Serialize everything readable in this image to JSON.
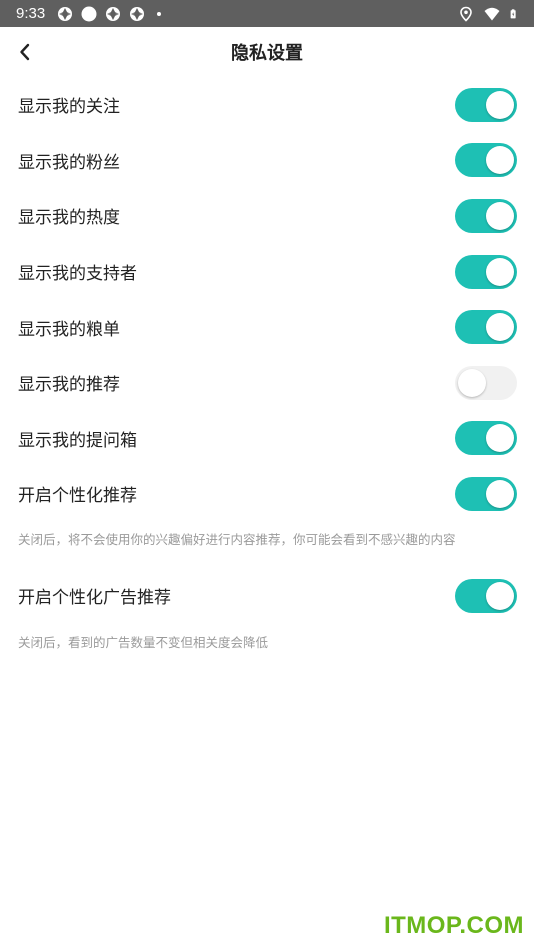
{
  "status_bar": {
    "time": "9:33",
    "left_icons": [
      "notification-icon",
      "record-icon",
      "notification-icon",
      "notification-icon",
      "more-dot-icon"
    ],
    "right_icons": [
      "location-icon",
      "wifi-icon",
      "battery-icon"
    ]
  },
  "header": {
    "title": "隐私设置",
    "back_icon": "chevron-left-icon"
  },
  "settings": [
    {
      "label": "显示我的关注",
      "enabled": true
    },
    {
      "label": "显示我的粉丝",
      "enabled": true
    },
    {
      "label": "显示我的热度",
      "enabled": true
    },
    {
      "label": "显示我的支持者",
      "enabled": true
    },
    {
      "label": "显示我的粮单",
      "enabled": true
    },
    {
      "label": "显示我的推荐",
      "enabled": false
    },
    {
      "label": "显示我的提问箱",
      "enabled": true
    },
    {
      "label": "开启个性化推荐",
      "enabled": true,
      "description": "关闭后，将不会使用你的兴趣偏好进行内容推荐，你可能会看到不感兴趣的内容"
    },
    {
      "label": "开启个性化广告推荐",
      "enabled": true,
      "description": "关闭后，看到的广告数量不变但相关度会降低"
    }
  ],
  "watermark": "ITMOP.COM",
  "colors": {
    "accent": "#1ec0b4",
    "toggle_off": "#f1f1f1",
    "status_bar": "#5f5f5f",
    "description_text": "#9a9a9a",
    "watermark": "#6ab71b"
  }
}
